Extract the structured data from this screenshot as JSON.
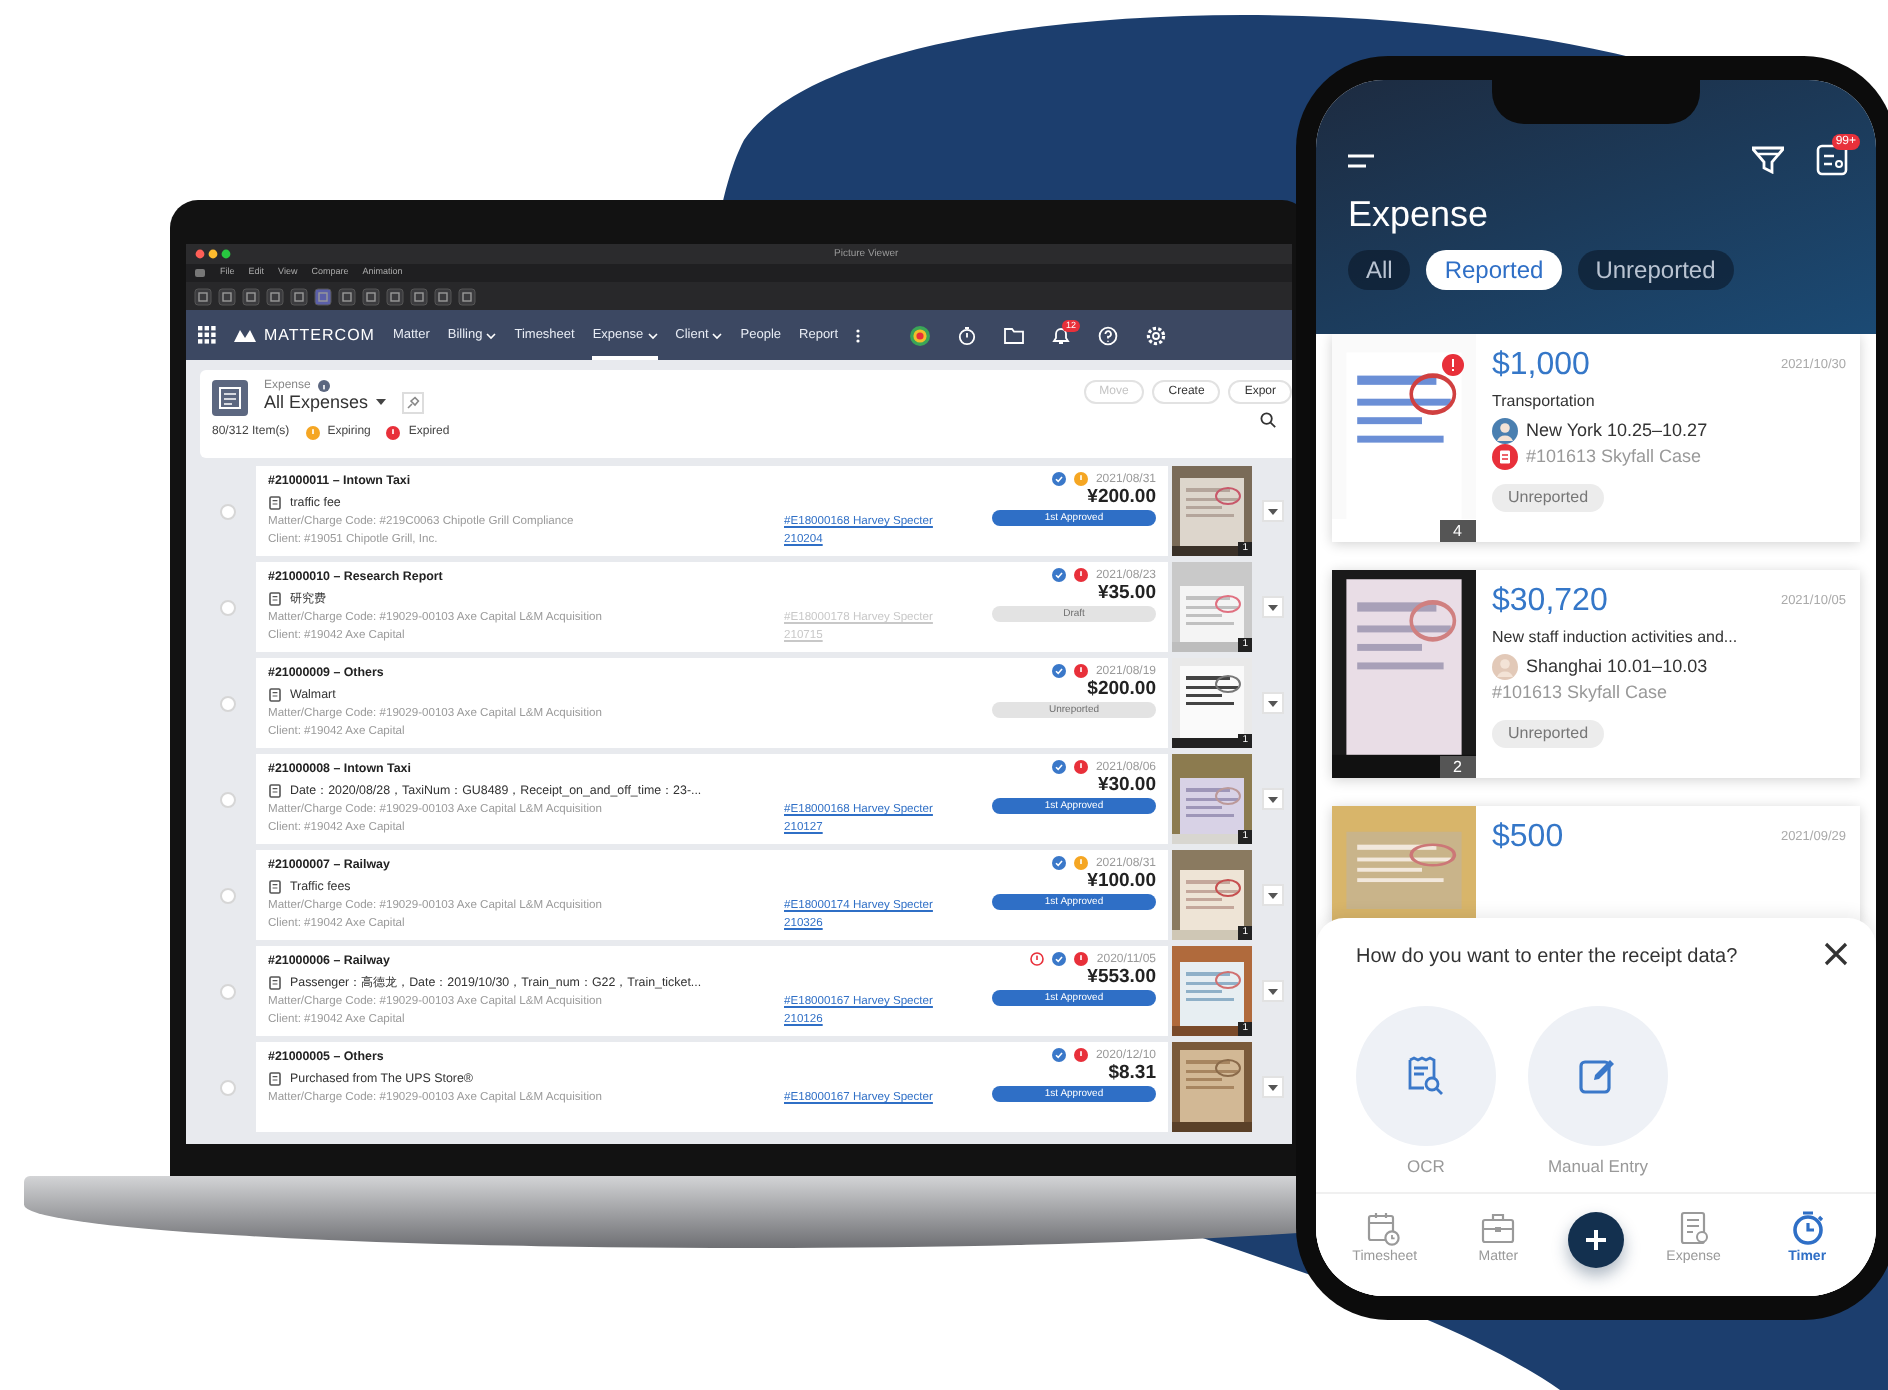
{
  "laptop": {
    "window": {
      "title": "Picture Viewer",
      "menu": [
        "File",
        "Edit",
        "View",
        "Compare",
        "Animation"
      ]
    },
    "nav": {
      "brand": "MATTERCOM",
      "notification_count": "12",
      "items": [
        {
          "label": "Matter",
          "dropdown": false,
          "selected": false
        },
        {
          "label": "Billing",
          "dropdown": true,
          "selected": false
        },
        {
          "label": "Timesheet",
          "dropdown": false,
          "selected": false
        },
        {
          "label": "Expense",
          "dropdown": true,
          "selected": true
        },
        {
          "label": "Client",
          "dropdown": true,
          "selected": false
        },
        {
          "label": "People",
          "dropdown": false,
          "selected": false
        },
        {
          "label": "Report",
          "dropdown": false,
          "selected": false
        }
      ]
    },
    "header": {
      "module": "Expense",
      "title": "All Expenses",
      "count": "80/312 Item(s)",
      "legend": [
        {
          "label": "Expiring",
          "color": "#f5a623"
        },
        {
          "label": "Expired",
          "color": "#e8303a"
        }
      ],
      "buttons": [
        {
          "label": "Move",
          "disabled": true
        },
        {
          "label": "Create",
          "disabled": false
        },
        {
          "label": "Expor",
          "disabled": false
        }
      ]
    },
    "rows": [
      {
        "checked": false,
        "title": "#21000011 – Intown Taxi",
        "description": "traffic fee",
        "matter": "Matter/Charge Code: #219C0063 Chipotle Grill Compliance",
        "client": "Client: #19051 Chipotle Grill, Inc.",
        "report": {
          "label": "#E18000168 Harvey Specter 210204",
          "disabled": false
        },
        "warning": false,
        "color": "#f5a623",
        "date": "2021/08/31",
        "amount": "¥200.00",
        "status": {
          "label": "1st Approved",
          "kind": "approved"
        },
        "photo_count": "1"
      },
      {
        "checked": false,
        "title": "#21000010 – Research Report",
        "description": "研究费",
        "matter": "Matter/Charge Code: #19029-00103 Axe Capital L&M Acquisition",
        "client": "Client: #19042 Axe Capital",
        "report": {
          "label": "#E18000178 Harvey Specter 210715",
          "disabled": true
        },
        "warning": false,
        "color": "#e8303a",
        "date": "2021/08/23",
        "amount": "¥35.00",
        "status": {
          "label": "Draft",
          "kind": "pending"
        },
        "photo_count": "1"
      },
      {
        "checked": false,
        "title": "#21000009 – Others",
        "description": "Walmart",
        "matter": "Matter/Charge Code: #19029-00103 Axe Capital L&M Acquisition",
        "client": "Client: #19042 Axe Capital",
        "warning": false,
        "color": "#e8303a",
        "date": "2021/08/19",
        "amount": "$200.00",
        "status": {
          "label": "Unreported",
          "kind": "pending"
        },
        "photo_count": "1"
      },
      {
        "checked": false,
        "title": "#21000008 – Intown Taxi",
        "description": "Date：2020/08/28，TaxiNum：GU8489，Receipt_on_and_off_time：23-...",
        "matter": "Matter/Charge Code: #19029-00103 Axe Capital L&M Acquisition",
        "client": "Client: #19042 Axe Capital",
        "report": {
          "label": "#E18000168 Harvey Specter 210127",
          "disabled": false
        },
        "warning": false,
        "color": "#e8303a",
        "date": "2021/08/06",
        "amount": "¥30.00",
        "status": {
          "label": "1st Approved",
          "kind": "approved"
        },
        "photo_count": "1"
      },
      {
        "checked": false,
        "title": "#21000007 – Railway",
        "description": "Traffic fees",
        "matter": "Matter/Charge Code: #19029-00103 Axe Capital L&M Acquisition",
        "client": "Client: #19042 Axe Capital",
        "report": {
          "label": "#E18000174 Harvey Specter 210326",
          "disabled": false
        },
        "warning": false,
        "color": "#f5a623",
        "date": "2021/08/31",
        "amount": "¥100.00",
        "status": {
          "label": "1st Approved",
          "kind": "approved"
        },
        "photo_count": "1"
      },
      {
        "checked": false,
        "title": "#21000006 – Railway",
        "description": "Passenger：高德龙，Date：2019/10/30，Train_num：G22，Train_ticket...",
        "matter": "Matter/Charge Code: #19029-00103 Axe Capital L&M Acquisition",
        "client": "Client: #19042 Axe Capital",
        "report": {
          "label": "#E18000167 Harvey Specter 210126",
          "disabled": false
        },
        "warning": true,
        "color": "#e8303a",
        "date": "2020/11/05",
        "amount": "¥553.00",
        "status": {
          "label": "1st Approved",
          "kind": "approved"
        },
        "photo_count": "1"
      },
      {
        "checked": false,
        "title": "#21000005 – Others",
        "description": "Purchased from The UPS Store®",
        "matter": "Matter/Charge Code: #19029-00103 Axe Capital L&M Acquisition",
        "report": {
          "label": "#E18000167 Harvey Specter",
          "disabled": false
        },
        "warning": false,
        "color": "#e8303a",
        "date": "2020/12/10",
        "amount": "$8.31",
        "status": {
          "label": "1st Approved",
          "kind": "approved"
        }
      }
    ]
  },
  "phone": {
    "title": "Expense",
    "notification_count": "99+",
    "tabs": [
      {
        "label": "All",
        "selected": false
      },
      {
        "label": "Reported",
        "selected": true
      },
      {
        "label": "Unreported",
        "selected": false
      }
    ],
    "cards": [
      {
        "amount": "$1,000",
        "date": "2021/10/30",
        "category": "Transportation",
        "trip": "New York 10.25–10.27",
        "case": "#101613 Skyfall Case",
        "case_icon": true,
        "status": "Unreported",
        "photo_count": "4",
        "alert": true
      },
      {
        "amount": "$30,720",
        "date": "2021/10/05",
        "category": "New staff induction activities and...",
        "trip": "Shanghai 10.01–10.03",
        "case": "#101613 Skyfall Case",
        "case_icon": false,
        "status": "Unreported",
        "photo_count": "2",
        "alert": false
      },
      {
        "amount": "$500",
        "date": "2021/09/29",
        "alert": false
      }
    ],
    "sheet": {
      "question": "How do you want to enter the receipt data?",
      "options": [
        {
          "label": "OCR",
          "kind": "ocr"
        },
        {
          "label": "Manual Entry",
          "kind": "manual"
        }
      ]
    },
    "tab_bar": [
      {
        "label": "Timesheet",
        "kind": "timesheet",
        "selected": false
      },
      {
        "label": "Matter",
        "kind": "matter",
        "selected": false
      },
      {
        "label": "Expense",
        "kind": "expense",
        "selected": false
      },
      {
        "label": "Timer",
        "kind": "timer",
        "selected": true
      }
    ]
  }
}
